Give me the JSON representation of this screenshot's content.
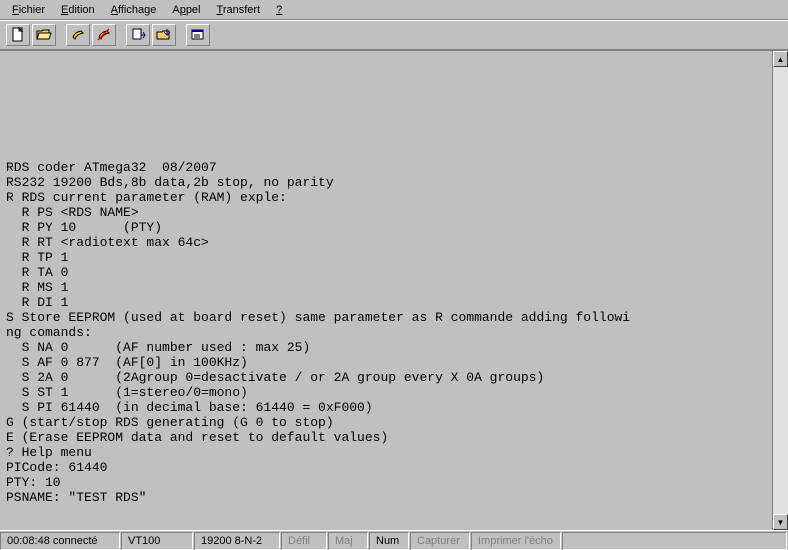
{
  "menu": {
    "file": "Fichier",
    "edit": "Edition",
    "view": "Affichage",
    "call": "Appel",
    "transfer": "Transfert",
    "help": "?"
  },
  "toolbar": {
    "new": "new-file-icon",
    "open": "open-file-icon",
    "call": "call-icon",
    "disconnect": "disconnect-icon",
    "send": "send-icon",
    "receive": "receive-icon",
    "properties": "properties-icon"
  },
  "terminal_text": "\n\n\n\n\n\n\nRDS coder ATmega32  08/2007\nRS232 19200 Bds,8b data,2b stop, no parity\nR RDS current parameter (RAM) exple:\n  R PS <RDS NAME>\n  R PY 10      (PTY)\n  R RT <radiotext max 64c>\n  R TP 1\n  R TA 0\n  R MS 1\n  R DI 1\nS Store EEPROM (used at board reset) same parameter as R commande adding followi\nng comands:\n  S NA 0      (AF number used : max 25)\n  S AF 0 877  (AF[0] in 100KHz)\n  S 2A 0      (2Agroup 0=desactivate / or 2A group every X 0A groups)\n  S ST 1      (1=stereo/0=mono)\n  S PI 61440  (in decimal base: 61440 = 0xF000)\nG (start/stop RDS generating (G 0 to stop)\nE (Erase EEPROM data and reset to default values)\n? Help menu\nPICode: 61440\nPTY: 10\nPSNAME: \"TEST RDS\"",
  "status": {
    "time": "00:08:48 connecté",
    "emu": "VT100",
    "port": "19200 8-N-2",
    "scroll": "Défil",
    "caps": "Maj",
    "num": "Num",
    "capture": "Capturer",
    "echo": "Imprimer l'écho"
  }
}
